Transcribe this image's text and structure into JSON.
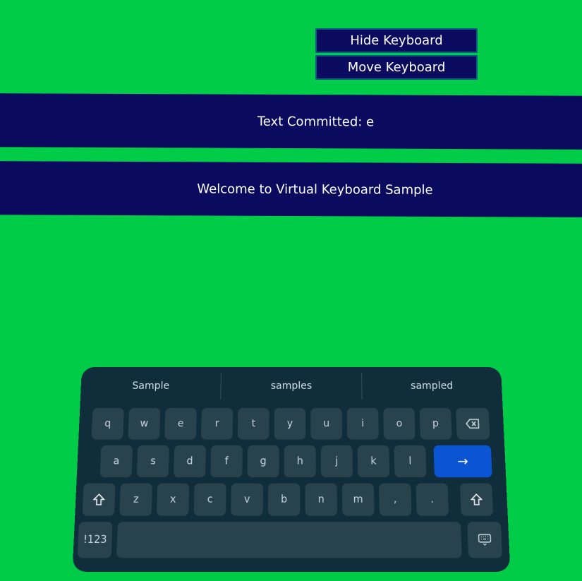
{
  "buttons": {
    "hide_keyboard": "Hide Keyboard",
    "move_keyboard": "Move Keyboard"
  },
  "banners": {
    "committed": "Text Committed: e",
    "welcome": "Welcome to Virtual Keyboard Sample"
  },
  "keyboard": {
    "suggestions": [
      "Sample",
      "samples",
      "sampled"
    ],
    "row1": [
      "q",
      "w",
      "e",
      "r",
      "t",
      "y",
      "u",
      "i",
      "o",
      "p"
    ],
    "row2": [
      "a",
      "s",
      "d",
      "f",
      "g",
      "h",
      "j",
      "k",
      "l"
    ],
    "row3": [
      "z",
      "x",
      "c",
      "v",
      "b",
      "n",
      "m",
      ",",
      "."
    ],
    "symbols_key": "!123",
    "backspace_icon": "backspace-icon",
    "enter_icon": "arrow-right-icon",
    "shift_icon": "shift-icon",
    "keyboard_icon": "keyboard-icon"
  },
  "colors": {
    "background": "#00cc48",
    "panel": "#0a0a5e",
    "keyboard_bg": "#0f2d3a",
    "key_bg": "#28424e",
    "enter_key": "#0b55d4"
  }
}
